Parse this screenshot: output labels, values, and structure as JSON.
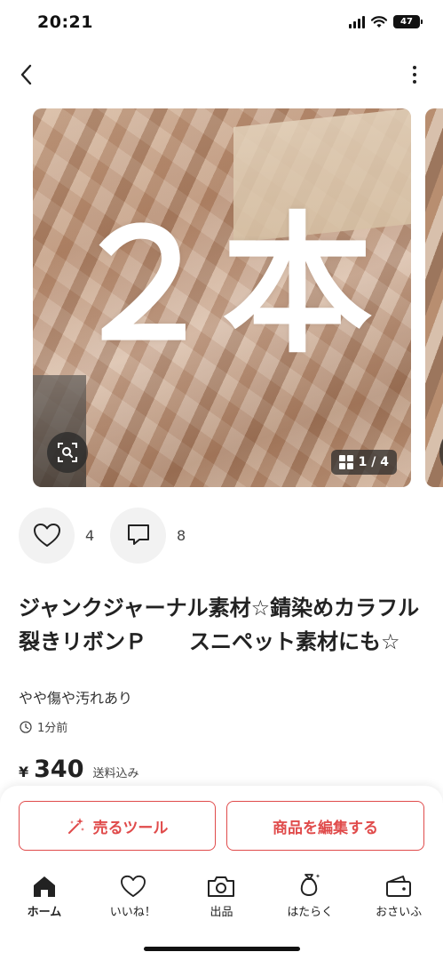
{
  "status_bar": {
    "time": "20:21",
    "battery": "47",
    "icons": [
      "signal-icon",
      "wifi-icon",
      "battery-icon"
    ]
  },
  "nav": {
    "back_icon": "chevron-left-icon",
    "more_icon": "more-vertical-icon"
  },
  "carousel": {
    "overlay_text": "２本",
    "counter": "1 / 4",
    "zoom_icon": "scan-search-icon",
    "counter_icon": "grid-icon"
  },
  "actions": {
    "like_count": "4",
    "comment_count": "8",
    "like_icon": "heart-icon",
    "comment_icon": "comment-icon"
  },
  "item": {
    "title": "ジャンクジャーナル素材☆錆染めカラフル裂きリボンＰ　　スニペット素材にも☆",
    "condition": "やや傷や汚れあり",
    "posted": "1分前",
    "currency": "¥",
    "price": "340",
    "shipping": "送料込み"
  },
  "buttons": {
    "sell_tool": "売るツール",
    "edit": "商品を編集する"
  },
  "tabs": [
    {
      "label": "ホーム",
      "icon": "home-icon"
    },
    {
      "label": "いいね！",
      "icon": "heart-icon"
    },
    {
      "label": "出品",
      "icon": "camera-icon"
    },
    {
      "label": "はたらく",
      "icon": "money-bag-icon"
    },
    {
      "label": "おさいふ",
      "icon": "wallet-icon"
    }
  ],
  "colors": {
    "accent": "#e04b4b",
    "text": "#222222",
    "circle_bg": "#f2f2f2"
  }
}
